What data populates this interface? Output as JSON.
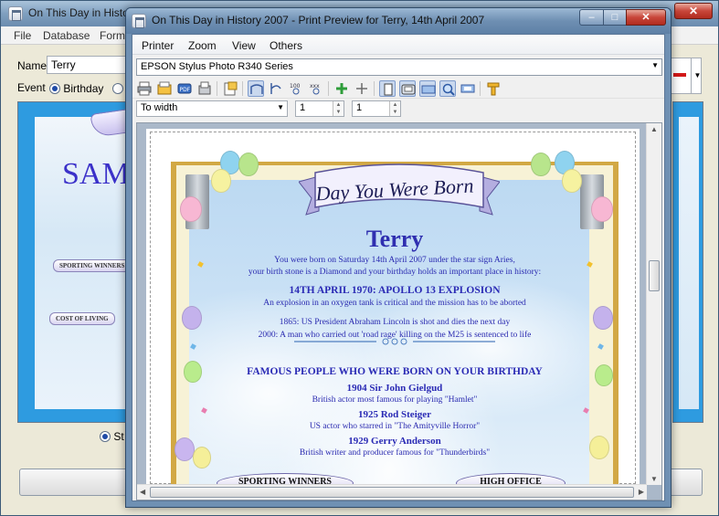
{
  "background_window": {
    "title": "On This Day in History",
    "close_glyph": "✕",
    "menu": [
      "File",
      "Database",
      "Form"
    ],
    "name_label": "Name",
    "name_value": "Terry",
    "event_label": "Event",
    "event_option": "Birthday",
    "preview_heading": "SAM",
    "preview_ribbons": [
      "SPORTING WINNERS",
      "COST OF LIVING"
    ],
    "bottom_option": "St",
    "dropdown_glyph": "▼"
  },
  "preview_window": {
    "title": "On This Day in History 2007 - Print Preview for Terry, 14th April 2007",
    "buttons": {
      "minimize": "–",
      "maximize": "□",
      "close": "✕"
    },
    "menu": [
      "Printer",
      "Zoom",
      "View",
      "Others"
    ],
    "printer": "EPSON Stylus Photo R340 Series",
    "zoom_mode": "To width",
    "page_from": "1",
    "page_to": "1",
    "toolbar_icons": [
      "print-icon",
      "print-setup-icon",
      "pdf-icon",
      "fax-icon",
      "export-icon",
      "page-width-icon",
      "page-height-icon",
      "zoom-100-icon",
      "zoom-custom-icon",
      "zoom-in-icon",
      "zoom-out-icon",
      "single-page-icon",
      "two-page-icon",
      "multi-page-icon",
      "magnify-icon",
      "fit-icon",
      "settings-icon"
    ]
  },
  "certificate": {
    "banner": "Day You Were Born",
    "name": "Terry",
    "intro_line1": "You were born on Saturday 14th April 2007 under the star sign Aries,",
    "intro_line2": "your birth stone is a Diamond and your birthday holds an important place in history:",
    "event_title": "14TH APRIL 1970: APOLLO 13 EXPLOSION",
    "event_desc": "An explosion in an oxygen tank is critical and the mission has to be aborted",
    "fact1": "1865: US President Abraham Lincoln is shot and dies the next day",
    "fact2": "2000: A man who carried out 'road rage' killing on the M25 is sentenced to life",
    "famous_heading": "FAMOUS PEOPLE WHO WERE BORN ON YOUR BIRTHDAY",
    "famous": [
      {
        "name": "1904 Sir John Gielgud",
        "desc": "British actor most famous for playing \"Hamlet\""
      },
      {
        "name": "1925 Rod Steiger",
        "desc": "US actor who starred in \"The Amityville Horror\""
      },
      {
        "name": "1929 Gerry Anderson",
        "desc": "British writer and producer famous for \"Thunderbirds\""
      }
    ],
    "bottom_ribbons": [
      "SPORTING WINNERS",
      "HIGH OFFICE"
    ]
  }
}
